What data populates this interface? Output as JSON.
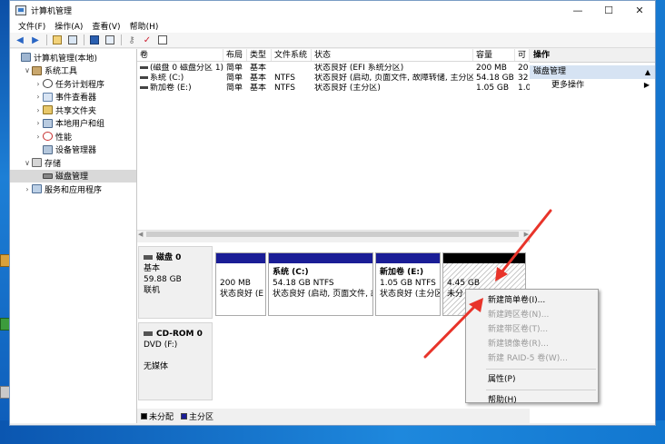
{
  "window": {
    "title": "计算机管理",
    "controls": [
      "—",
      "☐",
      "✕"
    ]
  },
  "menu": [
    "文件(F)",
    "操作(A)",
    "查看(V)",
    "帮助(H)"
  ],
  "toolbar": [
    "back-icon",
    "forward-icon",
    "folder-icon",
    "view-icon",
    "help-icon",
    "view2-icon",
    "key-icon",
    "check-icon",
    "doc-icon"
  ],
  "tree": [
    {
      "label": "计算机管理(本地)",
      "indent": 0,
      "chev": "",
      "icon": "ic-comp",
      "name": "tree-root"
    },
    {
      "label": "系统工具",
      "indent": 1,
      "chev": "∨",
      "icon": "ic-tools",
      "name": "tree-system-tools"
    },
    {
      "label": "任务计划程序",
      "indent": 2,
      "chev": "›",
      "icon": "ic-clock",
      "name": "tree-task-scheduler"
    },
    {
      "label": "事件查看器",
      "indent": 2,
      "chev": "›",
      "icon": "ic-event",
      "name": "tree-event-viewer"
    },
    {
      "label": "共享文件夹",
      "indent": 2,
      "chev": "›",
      "icon": "ic-share",
      "name": "tree-shared-folders"
    },
    {
      "label": "本地用户和组",
      "indent": 2,
      "chev": "›",
      "icon": "ic-users",
      "name": "tree-local-users"
    },
    {
      "label": "性能",
      "indent": 2,
      "chev": "›",
      "icon": "ic-perf",
      "name": "tree-performance"
    },
    {
      "label": "设备管理器",
      "indent": 2,
      "chev": "",
      "icon": "ic-dev",
      "name": "tree-device-manager"
    },
    {
      "label": "存储",
      "indent": 1,
      "chev": "∨",
      "icon": "ic-storage",
      "name": "tree-storage"
    },
    {
      "label": "磁盘管理",
      "indent": 2,
      "chev": "",
      "icon": "ic-disk",
      "name": "tree-disk-management",
      "selected": true
    },
    {
      "label": "服务和应用程序",
      "indent": 1,
      "chev": "›",
      "icon": "ic-svc",
      "name": "tree-services-apps"
    }
  ],
  "volumes": {
    "headers": [
      "卷",
      "布局",
      "类型",
      "文件系统",
      "状态",
      "容量",
      "可"
    ],
    "rows": [
      [
        "(磁盘 0 磁盘分区 1)",
        "简单",
        "基本",
        "",
        "状态良好 (EFI 系统分区)",
        "200 MB",
        "20"
      ],
      [
        "系统 (C:)",
        "简单",
        "基本",
        "NTFS",
        "状态良好 (启动, 页面文件, 故障转储, 主分区)",
        "54.18 GB",
        "32"
      ],
      [
        "新加卷 (E:)",
        "简单",
        "基本",
        "NTFS",
        "状态良好 (主分区)",
        "1.05 GB",
        "1.0"
      ]
    ]
  },
  "disk0": {
    "name": "磁盘 0",
    "type": "基本",
    "size": "59.88 GB",
    "status": "联机",
    "partitions": [
      {
        "title": "",
        "line1": "200 MB",
        "line2": "状态良好 (E",
        "name": "partition-efi"
      },
      {
        "title": "系统 (C:)",
        "line1": "54.18 GB NTFS",
        "line2": "状态良好 (启动, 页面文件, 故",
        "name": "partition-system-c"
      },
      {
        "title": "新加卷 (E:)",
        "line1": "1.05 GB NTFS",
        "line2": "状态良好 (主分区",
        "name": "partition-new-e"
      },
      {
        "title": "",
        "line1": "4.45 GB",
        "line2": "未分",
        "name": "partition-unallocated"
      }
    ]
  },
  "cdrom": {
    "name": "CD-ROM 0",
    "type": "DVD (F:)",
    "media": "无媒体"
  },
  "legend": [
    {
      "label": "未分配",
      "color": "#000000"
    },
    {
      "label": "主分区",
      "color": "#1a1d96"
    }
  ],
  "actions": {
    "header": "操作",
    "section": "磁盘管理",
    "item": "更多操作"
  },
  "context_menu": [
    {
      "label": "新建简单卷(I)...",
      "disabled": false
    },
    {
      "label": "新建跨区卷(N)...",
      "disabled": true
    },
    {
      "label": "新建带区卷(T)...",
      "disabled": true
    },
    {
      "label": "新建镜像卷(R)...",
      "disabled": true
    },
    {
      "label": "新建 RAID-5 卷(W)...",
      "disabled": true
    },
    {
      "sep": true
    },
    {
      "label": "属性(P)",
      "disabled": false
    },
    {
      "sep": true
    },
    {
      "label": "帮助(H)",
      "disabled": false
    }
  ],
  "accent": "#1a1d96",
  "annotation_color": "#e8342a"
}
